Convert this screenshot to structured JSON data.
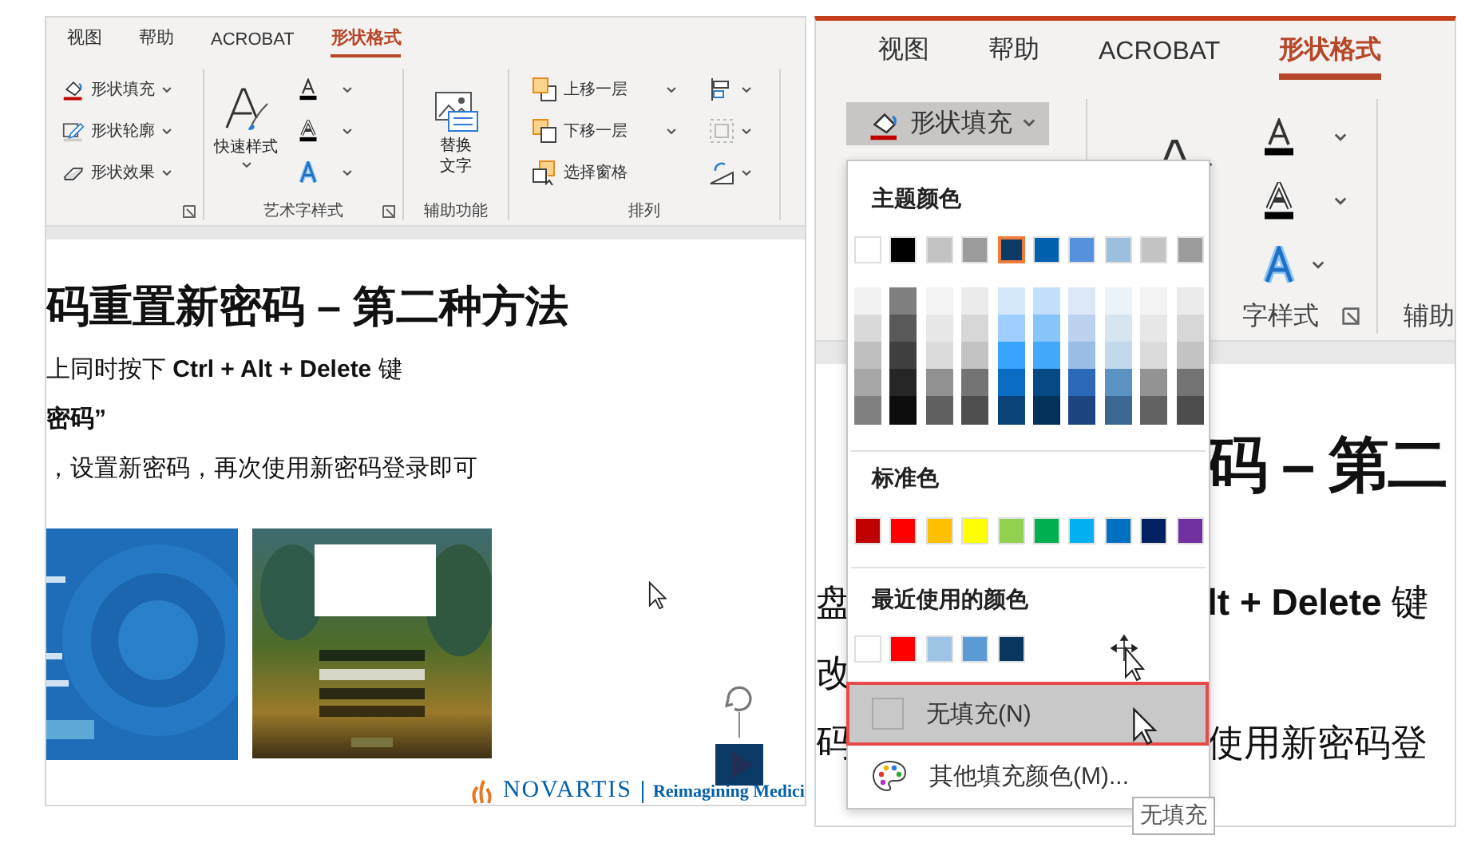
{
  "left": {
    "tabs": [
      {
        "label": "视图",
        "selected": false
      },
      {
        "label": "帮助",
        "selected": false
      },
      {
        "label": "ACROBAT",
        "selected": false
      },
      {
        "label": "形状格式",
        "selected": true
      }
    ],
    "shape_buttons": [
      {
        "label": "形状填充",
        "kind": "fill"
      },
      {
        "label": "形状轮廓",
        "kind": "outline"
      },
      {
        "label": "形状效果",
        "kind": "effects"
      }
    ],
    "wordart": {
      "quick_styles": "快速样式",
      "group": "艺术字样式"
    },
    "accessibility": {
      "button": "替换文字",
      "group": "辅助功能"
    },
    "arrange": {
      "buttons": [
        {
          "label": "上移一层",
          "kind": "forward"
        },
        {
          "label": "下移一层",
          "kind": "backward"
        },
        {
          "label": "选择窗格",
          "kind": "pane"
        }
      ],
      "group": "排列"
    },
    "slide": {
      "title": "码重置新密码 – 第二种方法",
      "lines": [
        {
          "text": "上同时按下 **Ctrl + Alt + Delete** 键",
          "bold": false
        },
        {
          "text": "密码”",
          "bold": true
        },
        {
          "text": "，设置新密码，再次使用新密码登录即可",
          "bold": false
        }
      ],
      "footer": {
        "brand": "NOVARTIS",
        "tagline": "Reimagining Medici"
      }
    }
  },
  "right": {
    "tabs": [
      {
        "label": "视图",
        "selected": false
      },
      {
        "label": "帮助",
        "selected": false
      },
      {
        "label": "ACROBAT",
        "selected": false
      },
      {
        "label": "形状格式",
        "selected": true
      }
    ],
    "fill_button": {
      "label": "形状填充",
      "pressed": true
    },
    "groups": [
      "字样式",
      "辅助"
    ],
    "menu": {
      "theme_title": "主题颜色",
      "theme_colors": [
        {
          "color": "#ffffff",
          "selected": false
        },
        {
          "color": "#000000",
          "selected": false
        },
        {
          "color": "#c3c3c3",
          "selected": false
        },
        {
          "color": "#9b9b9b",
          "selected": false
        },
        {
          "color": "#0b3a66",
          "selected": true
        },
        {
          "color": "#0060ad",
          "selected": false
        },
        {
          "color": "#5591dc",
          "selected": false
        },
        {
          "color": "#9bbfdc",
          "selected": false
        },
        {
          "color": "#c4c4c4",
          "selected": false
        },
        {
          "color": "#9c9c9c",
          "selected": false
        }
      ],
      "shades": [
        {
          "colors": [
            {
              "color": "#f2f2f2"
            },
            {
              "color": "#d9d9d9"
            },
            {
              "color": "#bfbfbf"
            },
            {
              "color": "#a6a6a6"
            },
            {
              "color": "#808080"
            }
          ]
        },
        {
          "colors": [
            {
              "color": "#7f7f7f"
            },
            {
              "color": "#595959"
            },
            {
              "color": "#404040"
            },
            {
              "color": "#262626"
            },
            {
              "color": "#0d0d0d"
            }
          ]
        },
        {
          "colors": [
            {
              "color": "#f3f3f3"
            },
            {
              "color": "#e7e7e7"
            },
            {
              "color": "#dbdbdb"
            },
            {
              "color": "#919191"
            },
            {
              "color": "#616161"
            }
          ]
        },
        {
          "colors": [
            {
              "color": "#ebebeb"
            },
            {
              "color": "#d7d7d7"
            },
            {
              "color": "#c3c3c3"
            },
            {
              "color": "#747474"
            },
            {
              "color": "#4e4e4e"
            }
          ]
        },
        {
          "colors": [
            {
              "color": "#d6e9fb"
            },
            {
              "color": "#a0cfff"
            },
            {
              "color": "#38a4ff"
            },
            {
              "color": "#0a6cc2"
            },
            {
              "color": "#0a4478"
            }
          ]
        },
        {
          "colors": [
            {
              "color": "#c2e0fb"
            },
            {
              "color": "#86c4fa"
            },
            {
              "color": "#42a8fa"
            },
            {
              "color": "#064a85"
            },
            {
              "color": "#03315a"
            }
          ]
        },
        {
          "colors": [
            {
              "color": "#dde8f7"
            },
            {
              "color": "#bcd2ee"
            },
            {
              "color": "#9abde5"
            },
            {
              "color": "#2b68b8"
            },
            {
              "color": "#1d4680"
            }
          ]
        },
        {
          "colors": [
            {
              "color": "#ebf2f8"
            },
            {
              "color": "#d7e5f1"
            },
            {
              "color": "#c3d8ea"
            },
            {
              "color": "#5a93c2"
            },
            {
              "color": "#3c6790"
            }
          ]
        },
        {
          "colors": [
            {
              "color": "#f3f3f3"
            },
            {
              "color": "#e7e7e7"
            },
            {
              "color": "#dbdbdb"
            },
            {
              "color": "#939393"
            },
            {
              "color": "#626262"
            }
          ]
        },
        {
          "colors": [
            {
              "color": "#ebebeb"
            },
            {
              "color": "#d7d7d7"
            },
            {
              "color": "#c3c3c3"
            },
            {
              "color": "#737373"
            },
            {
              "color": "#4d4d4d"
            }
          ]
        }
      ],
      "standard_title": "标准色",
      "standard_colors": [
        {
          "color": "#c00000"
        },
        {
          "color": "#ff0000"
        },
        {
          "color": "#ffc000"
        },
        {
          "color": "#ffff00"
        },
        {
          "color": "#92d050"
        },
        {
          "color": "#00b050"
        },
        {
          "color": "#00b0f0"
        },
        {
          "color": "#0070c0"
        },
        {
          "color": "#002060"
        },
        {
          "color": "#7030a0"
        }
      ],
      "recent_title": "最近使用的颜色",
      "recent_colors": [
        {
          "color": "#ffffff"
        },
        {
          "color": "#ff0000"
        },
        {
          "color": "#9dc3e6"
        },
        {
          "color": "#5b9bd5"
        },
        {
          "color": "#08365e"
        }
      ],
      "items": [
        {
          "label": "无填充(N)",
          "kind": "no-fill",
          "highlighted": true
        },
        {
          "label": "其他填充颜色(M)...",
          "kind": "more-colors",
          "highlighted": false
        }
      ],
      "tooltip": "无填充"
    },
    "slide": {
      "rows": [
        {
          "kind": "title",
          "right": "码 – 第二"
        },
        {
          "kind": "body",
          "left": "盘",
          "right": "**lt + Delete** 键"
        },
        {
          "kind": "body",
          "left": "改"
        },
        {
          "kind": "body",
          "left": "码",
          "right": "使用新密码登"
        }
      ]
    }
  }
}
